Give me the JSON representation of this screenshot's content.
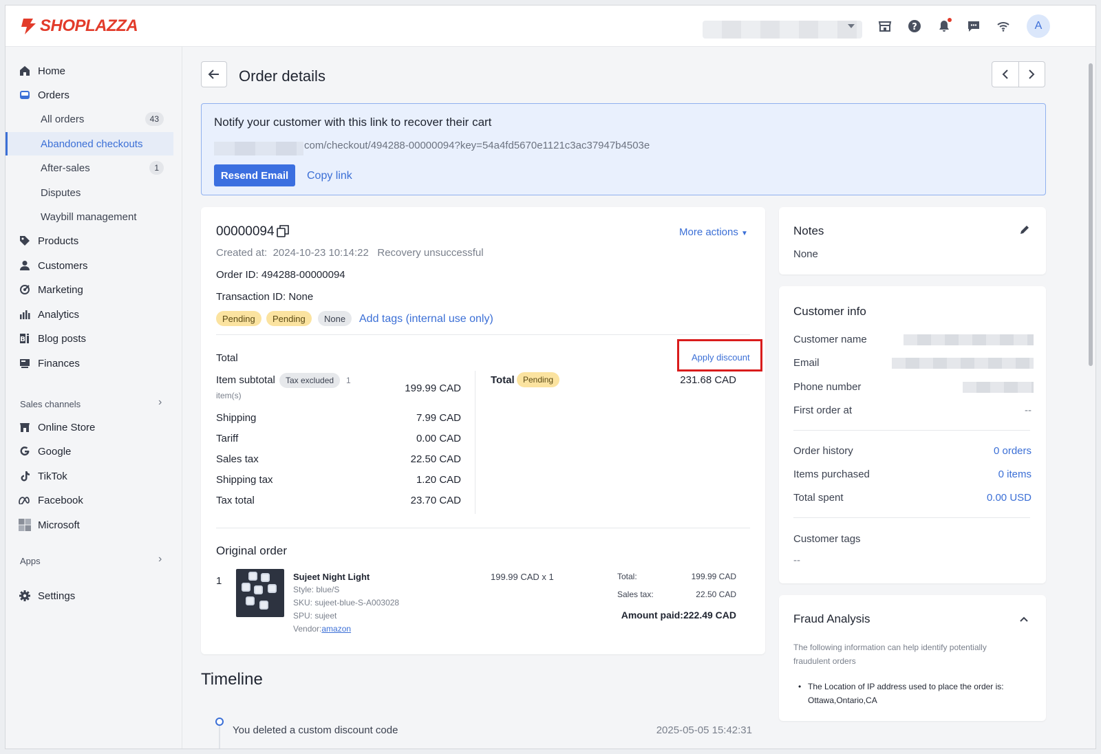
{
  "brand": {
    "logo_text": "SHOPLAZZA",
    "accent": "#3b6fd6",
    "logo_color": "#e23b2a"
  },
  "topbar": {
    "icons": [
      "store-icon",
      "help-icon",
      "bell-icon",
      "chat-icon",
      "wifi-icon"
    ],
    "avatar_initial": "A"
  },
  "sidebar": {
    "items": [
      {
        "label": "Home",
        "icon": "home-icon"
      },
      {
        "label": "Orders",
        "icon": "orders-icon"
      },
      {
        "label": "All orders",
        "badge": "43"
      },
      {
        "label": "Abandoned checkouts"
      },
      {
        "label": "After-sales",
        "badge": "1"
      },
      {
        "label": "Disputes"
      },
      {
        "label": "Waybill management"
      },
      {
        "label": "Products",
        "icon": "tag-icon"
      },
      {
        "label": "Customers",
        "icon": "person-icon"
      },
      {
        "label": "Marketing",
        "icon": "marketing-icon"
      },
      {
        "label": "Analytics",
        "icon": "bar-chart-icon"
      },
      {
        "label": "Blog posts",
        "icon": "blog-icon"
      },
      {
        "label": "Finances",
        "icon": "finances-icon"
      }
    ],
    "sales_channels_label": "Sales channels",
    "channels": [
      {
        "label": "Online Store",
        "icon": "store-icon"
      },
      {
        "label": "Google",
        "icon": "google-icon"
      },
      {
        "label": "TikTok",
        "icon": "tiktok-icon"
      },
      {
        "label": "Facebook",
        "icon": "meta-icon"
      },
      {
        "label": "Microsoft",
        "icon": "microsoft-icon"
      }
    ],
    "apps_label": "Apps",
    "settings_label": "Settings"
  },
  "page": {
    "title": "Order details"
  },
  "notify": {
    "title": "Notify your customer with this link to recover their cart",
    "url": "com/checkout/494288-00000094?key=54a4fd5670e1121c3ac37947b4503e",
    "resend_label": "Resend Email",
    "copy_label": "Copy link"
  },
  "order": {
    "number": "00000094",
    "more_actions": "More actions",
    "created_label": "Created at:",
    "created_value": "2024-10-23 10:14:22",
    "recovery_status": "Recovery unsuccessful",
    "order_id": "Order ID: 494288-00000094",
    "transaction_id": "Transaction ID: None",
    "tags": [
      "Pending",
      "Pending",
      "None"
    ],
    "add_tags": "Add tags (internal use only)",
    "total_label": "Total",
    "apply_discount": "Apply discount",
    "item_subtotal_label": "Item subtotal",
    "tax_excluded": "Tax excluded",
    "item_count_num": "1",
    "item_count_unit": "item(s)",
    "summary": [
      {
        "label": "Shipping",
        "value": "7.99 CAD"
      },
      {
        "label": "Tariff",
        "value": "0.00 CAD"
      },
      {
        "label": "Sales tax",
        "value": "22.50 CAD"
      },
      {
        "label": "Shipping tax",
        "value": "1.20 CAD"
      },
      {
        "label": "Tax total",
        "value": "23.70 CAD"
      }
    ],
    "item_subtotal_value": "199.99 CAD",
    "grand_total_label": "Total",
    "grand_total_status": "Pending",
    "grand_total_value": "231.68 CAD"
  },
  "original_order": {
    "title": "Original order",
    "line_no": "1",
    "product_name": "Sujeet Night Light",
    "style": "Style: blue/S",
    "sku": "SKU: sujeet-blue-S-A003028",
    "spu": "SPU: sujeet",
    "vendor_label": "Vendor:",
    "vendor_link": "amazon",
    "price_qty": "199.99 CAD x 1",
    "total_label": "Total:",
    "total_value": "199.99 CAD",
    "tax_label": "Sales tax:",
    "tax_value": "22.50 CAD",
    "amount_paid": "Amount paid:222.49 CAD"
  },
  "notes": {
    "title": "Notes",
    "value": "None"
  },
  "customer": {
    "title": "Customer info",
    "name_label": "Customer name",
    "email_label": "Email",
    "phone_label": "Phone number",
    "first_order_label": "First order at",
    "first_order_value": "--",
    "history_label": "Order history",
    "history_value": "0 orders",
    "items_label": "Items purchased",
    "items_value": "0 items",
    "spent_label": "Total spent",
    "spent_value": "0.00 USD",
    "tags_label": "Customer tags",
    "tags_value": "--"
  },
  "fraud": {
    "title": "Fraud Analysis",
    "desc": "The following information can help identify potentially fraudulent orders",
    "bullet": "The Location of IP address used to place the order is: Ottawa,Ontario,CA"
  },
  "timeline": {
    "title": "Timeline",
    "events": [
      {
        "text": "You deleted a custom discount code",
        "time": "2025-05-05 15:42:31"
      }
    ]
  }
}
